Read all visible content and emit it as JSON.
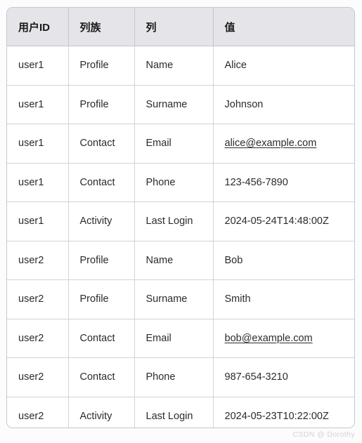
{
  "table": {
    "headers": [
      "用户ID",
      "列族",
      "列",
      "值"
    ],
    "rows": [
      {
        "user_id": "user1",
        "column_family": "Profile",
        "column": "Name",
        "value": "Alice",
        "is_link": false
      },
      {
        "user_id": "user1",
        "column_family": "Profile",
        "column": "Surname",
        "value": "Johnson",
        "is_link": false
      },
      {
        "user_id": "user1",
        "column_family": "Contact",
        "column": "Email",
        "value": "alice@example.com",
        "is_link": true
      },
      {
        "user_id": "user1",
        "column_family": "Contact",
        "column": "Phone",
        "value": "123-456-7890",
        "is_link": false
      },
      {
        "user_id": "user1",
        "column_family": "Activity",
        "column": "Last Login",
        "value": "2024-05-24T14:48:00Z",
        "is_link": false
      },
      {
        "user_id": "user2",
        "column_family": "Profile",
        "column": "Name",
        "value": "Bob",
        "is_link": false
      },
      {
        "user_id": "user2",
        "column_family": "Profile",
        "column": "Surname",
        "value": "Smith",
        "is_link": false
      },
      {
        "user_id": "user2",
        "column_family": "Contact",
        "column": "Email",
        "value": "bob@example.com",
        "is_link": true
      },
      {
        "user_id": "user2",
        "column_family": "Contact",
        "column": "Phone",
        "value": "987-654-3210",
        "is_link": false
      },
      {
        "user_id": "user2",
        "column_family": "Activity",
        "column": "Last Login",
        "value": "2024-05-23T10:22:00Z",
        "is_link": false
      }
    ]
  },
  "watermark": {
    "text": "CSDN @ Dorothy"
  },
  "colors": {
    "header_background": "#e4e4e9",
    "row_background": "#ffffff",
    "border": "#c6c6d0",
    "row_border": "#d3d3da",
    "text": "#2b2b2b",
    "header_text": "#1a1a1a",
    "page_background": "#fcfcfd",
    "watermark_text": "#d2d2d8"
  }
}
